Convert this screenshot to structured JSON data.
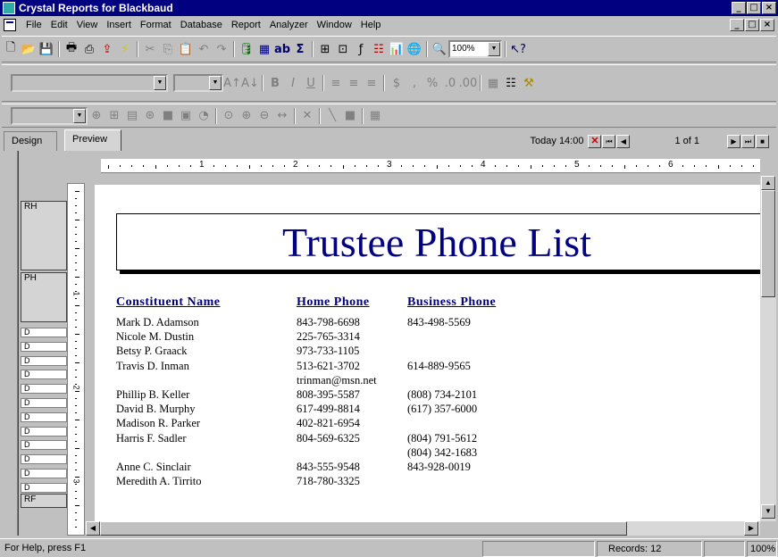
{
  "window": {
    "title": "Crystal Reports for Blackbaud",
    "controls": [
      "_",
      "□",
      "×"
    ]
  },
  "menu": [
    "File",
    "Edit",
    "View",
    "Insert",
    "Format",
    "Database",
    "Report",
    "Analyzer",
    "Window",
    "Help"
  ],
  "toolbar": {
    "zoom_value": "100%"
  },
  "tabs": {
    "design": "Design",
    "preview": "Preview",
    "active": "Preview"
  },
  "preview_info": {
    "timestamp": "Today  14:00",
    "page": "1 of 1"
  },
  "ruler": {
    "marks": [
      "1",
      "2",
      "3",
      "4",
      "5",
      "6"
    ],
    "vmarks": [
      "1",
      "2",
      "3"
    ]
  },
  "sections": {
    "rh": "RH",
    "ph": "PH",
    "d": "D",
    "rf": "RF"
  },
  "report": {
    "title": "Trustee Phone List",
    "columns": {
      "name": "Constituent Name",
      "home": "Home Phone",
      "business": "Business Phone"
    },
    "rows": [
      {
        "name": "Mark D. Adamson",
        "home": "843-798-6698",
        "business": "843-498-5569"
      },
      {
        "name": "Nicole M. Dustin",
        "home": "225-765-3314",
        "business": ""
      },
      {
        "name": "Betsy P. Graack",
        "home": "973-733-1105",
        "business": ""
      },
      {
        "name": "Travis D. Inman",
        "home": "513-621-3702",
        "business": "614-889-9565"
      },
      {
        "name": "",
        "home": "trinman@msn.net",
        "business": ""
      },
      {
        "name": "Phillip B. Keller",
        "home": "808-395-5587",
        "business": "(808) 734-2101"
      },
      {
        "name": "David B. Murphy",
        "home": "617-499-8814",
        "business": "(617) 357-6000"
      },
      {
        "name": "Madison R. Parker",
        "home": "402-821-6954",
        "business": ""
      },
      {
        "name": "Harris F. Sadler",
        "home": "804-569-6325",
        "business": "(804) 791-5612"
      },
      {
        "name": "",
        "home": "",
        "business": "(804) 342-1683"
      },
      {
        "name": "Anne C. Sinclair",
        "home": "843-555-9548",
        "business": "843-928-0019"
      },
      {
        "name": "Meredith A. Tirrito",
        "home": "718-780-3325",
        "business": ""
      }
    ]
  },
  "status": {
    "help": "For Help, press F1",
    "records": "Records: 12",
    "zoom": "100%"
  },
  "colors": {
    "titlebar": "#000080",
    "report_title": "#000080"
  }
}
